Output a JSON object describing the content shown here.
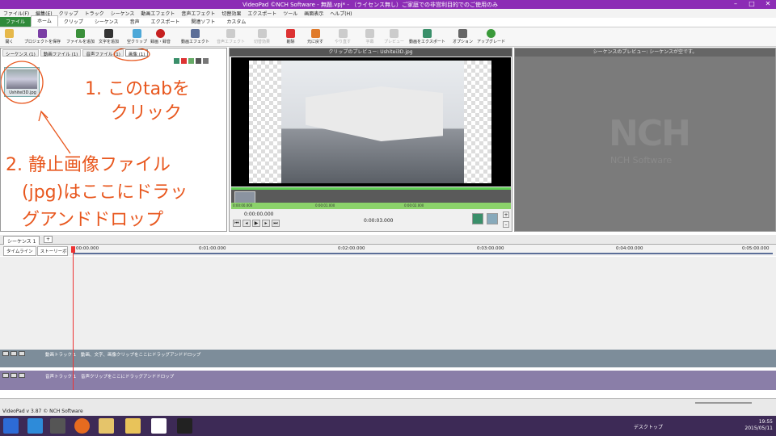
{
  "window": {
    "title": "VideoPad ©NCH Software - 無題.vpj* - （ライセンス無し）ご家庭での非営利目的でのご使用のみ"
  },
  "menu": [
    "ファイル(F)",
    "編集(E)",
    "クリップ",
    "トラック",
    "シーケンス",
    "動画エフェクト",
    "音声エフェクト",
    "切替効果",
    "エクスポート",
    "ツール",
    "画面表示",
    "ヘルプ(H)"
  ],
  "ribbon_tabs": [
    "ファイル",
    "ホーム",
    "クリップ",
    "シーケンス",
    "音声",
    "エクスポート",
    "関連ソフト",
    "カスタム"
  ],
  "toolbar": [
    "開く",
    "プロジェクトを保存",
    "ファイルを追加",
    "文字を追加",
    "空クリップ",
    "録画・録音",
    "動画エフェクト",
    "音声エフェクト",
    "切替効果",
    "削除",
    "元に戻す",
    "やり直す",
    "字幕",
    "プレビュー",
    "動画をエクスポート",
    "オプション",
    "アップグレード"
  ],
  "bin": {
    "tabs": [
      "シーケンス (1)",
      "動画ファイル (1)",
      "音声ファイル (1)",
      "画像 (1)"
    ],
    "thumb_label": "Ushitei3D.jpg"
  },
  "annotations": {
    "a1_line1": "1. このtabを",
    "a1_line2": "クリック",
    "a2_line1": "2. 静止画像ファイル",
    "a2_line2": "(jpg)はここにドラッ",
    "a2_line3": "グアンドドロップ"
  },
  "clip_preview": {
    "title": "クリップのプレビュー: Ushitei3D.jpg",
    "time_current": "0:00:00.000",
    "time_total": "0:00:03.000",
    "ruler": [
      "0:00:00.000",
      "0:00:01.000",
      "0:00:02.000"
    ]
  },
  "seq_preview": {
    "title": "シーケンスのプレビュー: シーケンスが空です。",
    "logo": "NCH",
    "logo_sub": "NCH Software"
  },
  "timeline": {
    "seq_tab": "シーケンス 1",
    "modes": [
      "タイムライン",
      "ストーリーボード"
    ],
    "ruler": [
      "00:00.000",
      "0:01:00.000",
      "0:02:00.000",
      "0:03:00.000",
      "0:04:00.000",
      "0:05:00.000"
    ],
    "video_track": "動画トラック 1",
    "video_hint": "動画、文字、画像クリップをここにドラッグアンドドロップ",
    "audio_track": "音声トラック 1",
    "audio_hint": "音声クリップをここにドラッグアンドドロップ"
  },
  "status": {
    "version": "VideoPad v 3.87 © NCH Software"
  },
  "taskbar": {
    "desktop": "デスクトップ",
    "time": "19:55",
    "date": "2015/05/11"
  },
  "colors": {
    "titlebar": "#8c2cb5",
    "annotation": "#e8571e",
    "taskbar": "#3d2a56"
  }
}
